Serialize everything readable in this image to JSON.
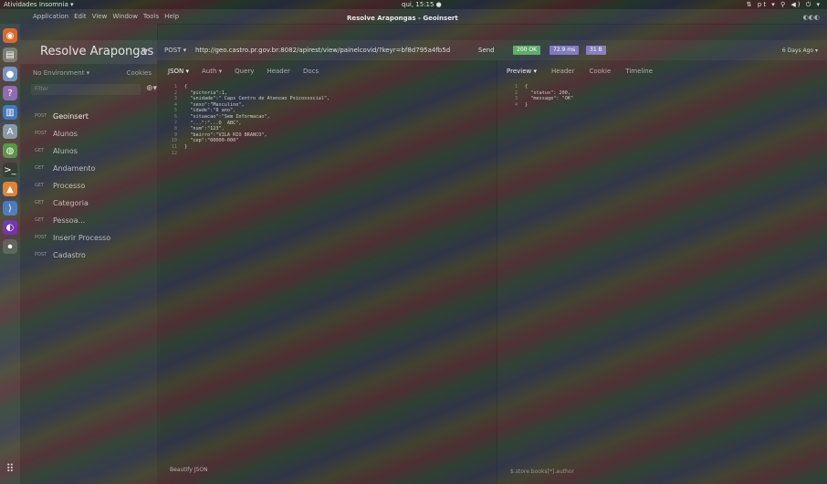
{
  "system": {
    "activities": "Atividades",
    "app_menu": "Insomnia ▾",
    "clock": "qui, 15:15 ●",
    "tray": "⇅ pt ▾  ⚲ ◀) ⏻ ▾"
  },
  "window": {
    "title": "Resolve Arapongas - Geoinsert",
    "menu": [
      "Application",
      "Edit",
      "View",
      "Window",
      "Tools",
      "Help"
    ],
    "controls": "◐◐◐"
  },
  "dock": {
    "items": [
      {
        "icon": "firefox-icon",
        "glyph": "◉",
        "color": "#d65d0e"
      },
      {
        "icon": "files-icon",
        "glyph": "▤",
        "color": "#6e6e6e"
      },
      {
        "icon": "ubuntu-software-icon",
        "glyph": "●",
        "color": "#5c8fc0"
      },
      {
        "icon": "help-icon",
        "glyph": "?",
        "color": "#8a5ca8"
      },
      {
        "icon": "text-editor-icon",
        "glyph": "▥",
        "color": "#3d6fb0"
      },
      {
        "icon": "font-viewer-icon",
        "glyph": "A",
        "color": "#7b8ea3"
      },
      {
        "icon": "chrome-icon",
        "glyph": "◍",
        "color": "#3e8e41"
      },
      {
        "icon": "terminal-icon",
        "glyph": ">_",
        "color": "#2a2a2a"
      },
      {
        "icon": "vlc-icon",
        "glyph": "▲",
        "color": "#e0781e"
      },
      {
        "icon": "vscode-icon",
        "glyph": "⟩",
        "color": "#3a6db8"
      },
      {
        "icon": "insomnia-icon",
        "glyph": "◐",
        "color": "#5a2aa8"
      },
      {
        "icon": "settings-icon",
        "glyph": "⏺",
        "color": "#555"
      }
    ],
    "apps_glyph": "⠿"
  },
  "sidebar": {
    "workspace": "Resolve Arapongas",
    "environment": "No Environment ▾",
    "cookies": "Cookies",
    "filter_placeholder": "Filter",
    "plus": "⊕▾",
    "requests": [
      {
        "method": "POST",
        "name": "Geoinsert",
        "active": true
      },
      {
        "method": "POST",
        "name": "Alunos"
      },
      {
        "method": "GET",
        "name": "Alunos"
      },
      {
        "method": "GET",
        "name": "Andamento"
      },
      {
        "method": "GET",
        "name": "Processo"
      },
      {
        "method": "GET",
        "name": "Categoria"
      },
      {
        "method": "GET",
        "name": "Pessoa..."
      },
      {
        "method": "POST",
        "name": "Inserir Processo"
      },
      {
        "method": "POST",
        "name": "Cadastro"
      }
    ]
  },
  "request": {
    "method": "POST ▾",
    "url": "http://geo.castro.pr.gov.br:8082/apirest/view/painelcovid/?keyr=bf8d795a4fb5d",
    "send": "Send",
    "tabs": [
      "JSON ▾",
      "Auth ▾",
      "Query",
      "Header",
      "Docs"
    ],
    "body_lines": [
      "{",
      "  \"pictoria\":1,",
      "  \"unidade\":\" Caps Centro de Atencao Psicossocial\",",
      "  \"sexo\":\"Masculino\",",
      "  \"idade\":\"8 ano\",",
      "  \"situacao\":\"Sem Informacao\",",
      "  \"...\":\"...O  ABC\",",
      "  \"num\":\"123\",",
      "  \"bairro\":\"VILA RIO BRANCO\",",
      "  \"cep\":\"00000-000\"",
      "}",
      ""
    ],
    "beautify": "Beautify JSON"
  },
  "response": {
    "status": "200 OK",
    "status_color": "#5aa55a",
    "time": "72.9 ms",
    "time_color": "#7a6fb8",
    "size": "31 B",
    "size_color": "#7a6fb8",
    "ago": "6 Days Ago ▾",
    "tabs": [
      "Preview ▾",
      "Header",
      "Cookie",
      "Timeline"
    ],
    "body_lines": [
      "{",
      "  \"status\": 200,",
      "  \"message\": \"OK\"",
      "}"
    ],
    "footer": "$.store.books[*].author"
  }
}
